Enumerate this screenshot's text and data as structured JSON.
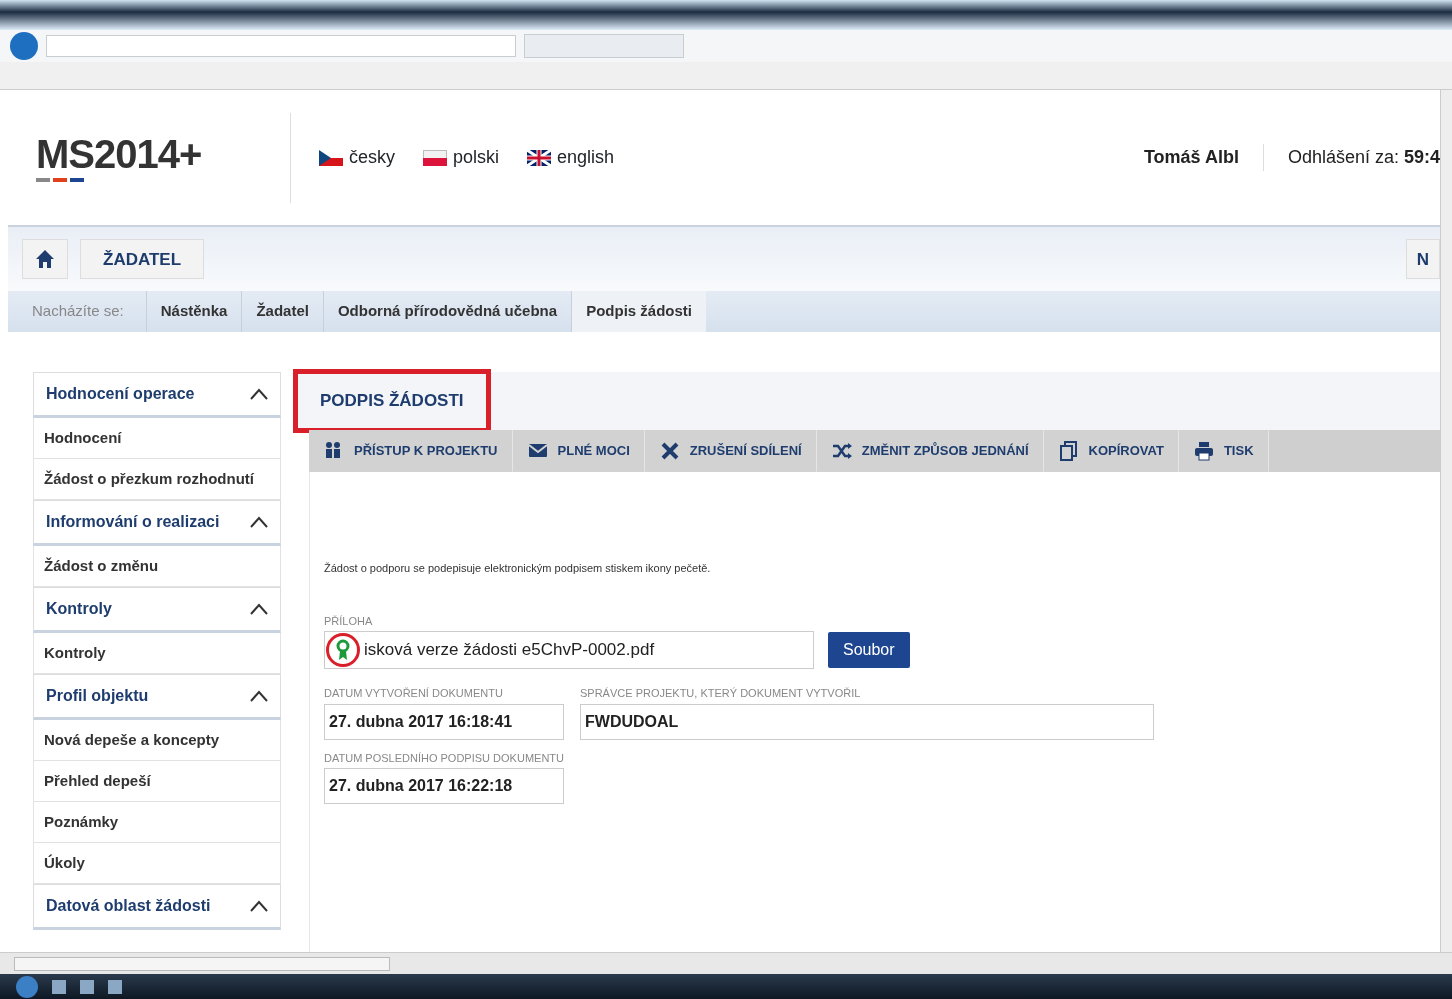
{
  "header": {
    "logo": "MS2014+",
    "languages": [
      {
        "label": "česky",
        "kind": "cz"
      },
      {
        "label": "polski",
        "kind": "pl"
      },
      {
        "label": "english",
        "kind": "gb"
      }
    ],
    "user": "Tomáš Albl",
    "logout_label": "Odhlášení za:",
    "logout_time": "59:4"
  },
  "nav": {
    "items": [
      "ŽADATEL"
    ],
    "right_cut": "N"
  },
  "breadcrumb": {
    "label": "Nacházíte se:",
    "items": [
      "Nástěnka",
      "Žadatel",
      "Odborná přírodovědná učebna",
      "Podpis žádosti"
    ]
  },
  "sidebar": [
    {
      "title": "Hodnocení operace",
      "expanded": true,
      "children": [
        "Hodnocení",
        "Žádost o přezkum rozhodnutí"
      ]
    },
    {
      "title": "Informování o realizaci",
      "expanded": true,
      "children": [
        "Žádost o změnu"
      ]
    },
    {
      "title": "Kontroly",
      "expanded": true,
      "children": [
        "Kontroly"
      ]
    },
    {
      "title": "Profil objektu",
      "expanded": true,
      "children": [
        "Nová depeše a koncepty",
        "Přehled depeší",
        "Poznámky",
        "Úkoly"
      ]
    },
    {
      "title": "Datová oblast žádosti",
      "expanded": true
    }
  ],
  "page": {
    "title": "PODPIS ŽÁDOSTI",
    "title_highlighted": true,
    "toolbar": [
      {
        "label": "PŘÍSTUP K PROJEKTU",
        "kind": "people"
      },
      {
        "label": "PLNÉ MOCI",
        "kind": "mail"
      },
      {
        "label": "ZRUŠENÍ SDÍLENÍ",
        "kind": "cross"
      },
      {
        "label": "ZMĚNIT ZPŮSOB JEDNÁNÍ",
        "kind": "shuffle"
      },
      {
        "label": "KOPÍROVAT",
        "kind": "copy"
      },
      {
        "label": "TISK",
        "kind": "print"
      }
    ],
    "info": "Žádost o podporu se podepisuje elektronickým podpisem stiskem ikony pečetě.",
    "attachment": {
      "label": "PŘÍLOHA",
      "value": "isková verze žádosti e5ChvP-0002.pdf",
      "seal_highlighted": true,
      "button": "Soubor"
    },
    "fields": [
      {
        "label": "DATUM VYTVOŘENÍ DOKUMENTU",
        "value": "27. dubna 2017 16:18:41",
        "wide": false
      },
      {
        "label": "SPRÁVCE PROJEKTU, KTERÝ DOKUMENT VYTVOŘIL",
        "value": "FWDUDOAL",
        "wide": true
      },
      {
        "label": "DATUM POSLEDNÍHO PODPISU DOKUMENTU",
        "value": "27. dubna 2017 16:22:18",
        "wide": false
      }
    ]
  }
}
